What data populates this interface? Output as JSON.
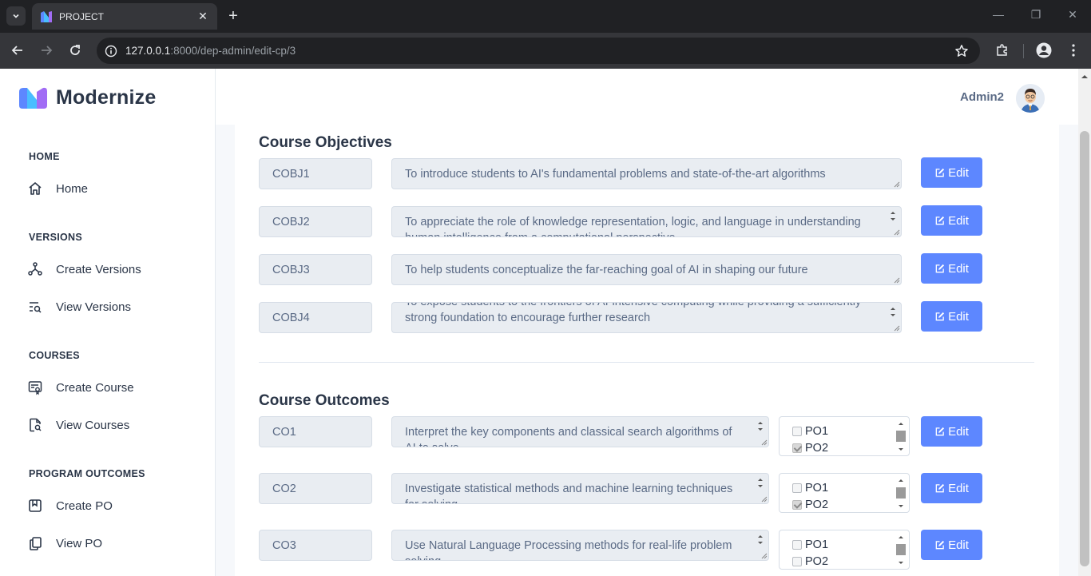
{
  "browser": {
    "tab_title": "PROJECT",
    "url_host": "127.0.0.1",
    "url_path": ":8000/dep-admin/edit-cp/3"
  },
  "app": {
    "brand": "Modernize",
    "user_name": "Admin2"
  },
  "sidebar": {
    "sections": [
      {
        "title": "HOME",
        "items": [
          {
            "label": "Home",
            "icon": "home-icon"
          }
        ]
      },
      {
        "title": "VERSIONS",
        "items": [
          {
            "label": "Create Versions",
            "icon": "git-branch-icon"
          },
          {
            "label": "View Versions",
            "icon": "list-search-icon"
          }
        ]
      },
      {
        "title": "COURSES",
        "items": [
          {
            "label": "Create Course",
            "icon": "certificate-icon"
          },
          {
            "label": "View Courses",
            "icon": "file-search-icon"
          }
        ]
      },
      {
        "title": "PROGRAM OUTCOMES",
        "items": [
          {
            "label": "Create PO",
            "icon": "bookmark-icon"
          },
          {
            "label": "View PO",
            "icon": "copy-icon"
          }
        ]
      }
    ]
  },
  "objectives": {
    "title": "Course Objectives",
    "rows": [
      {
        "code": "COBJ1",
        "text": "To introduce students to AI's fundamental problems and state-of-the-art algorithms"
      },
      {
        "code": "COBJ2",
        "text": "To appreciate the role of knowledge representation, logic, and language in understanding human intelligence from a computational perspective"
      },
      {
        "code": "COBJ3",
        "text": "To help students conceptualize the far-reaching goal of AI in shaping our future"
      },
      {
        "code": "COBJ4",
        "text": "To expose students to the frontiers of AI-intensive computing while providing a sufficiently strong foundation to encourage further research"
      }
    ]
  },
  "outcomes": {
    "title": "Course Outcomes",
    "rows": [
      {
        "code": "CO1",
        "text": "Interpret the key components and classical search algorithms of AI to solve",
        "po": [
          {
            "label": "PO1",
            "checked": false
          },
          {
            "label": "PO2",
            "checked": true
          }
        ]
      },
      {
        "code": "CO2",
        "text": "Investigate statistical methods and machine learning techniques for solving",
        "po": [
          {
            "label": "PO1",
            "checked": false
          },
          {
            "label": "PO2",
            "checked": true
          }
        ]
      },
      {
        "code": "CO3",
        "text": "Use Natural Language Processing methods for real-life problem solving",
        "po": [
          {
            "label": "PO1",
            "checked": false
          },
          {
            "label": "PO2",
            "checked": false
          }
        ]
      }
    ]
  },
  "edit_label": "Edit",
  "colors": {
    "accent": "#5d87ff",
    "text": "#2a3547",
    "muted": "#5a6a85",
    "field_bg": "#e9edf2"
  }
}
